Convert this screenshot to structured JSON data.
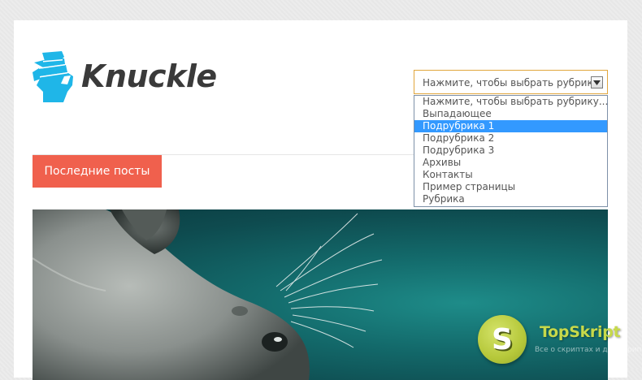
{
  "brand": {
    "name": "Knuckle",
    "logo_icon": "fist-icon",
    "accent_color": "#1fb6e8",
    "text_color": "#3a3a3a"
  },
  "nav": {
    "recent_posts_label": "Последние посты",
    "button_color": "#f0604d"
  },
  "category_select": {
    "current_value": "Нажмите, чтобы выбрать рубрику...",
    "border_color": "#e1a63c",
    "options": [
      "Нажмите, чтобы выбрать рубрику...",
      "Выпадающее",
      "Подрубрика 1",
      "Подрубрика 2",
      "Подрубрика 3",
      "Архивы",
      "Контакты",
      "Пример страницы",
      "Рубрика"
    ],
    "highlighted_option": "Подрубрика 1",
    "highlight_color": "#3399ff"
  },
  "hero": {
    "image_subject": "cat-photo"
  },
  "watermark": {
    "letter": "S",
    "title": "TopSkript",
    "subtitle": "Все о скриптах и для скриптов...",
    "color": "#c7d94a"
  }
}
